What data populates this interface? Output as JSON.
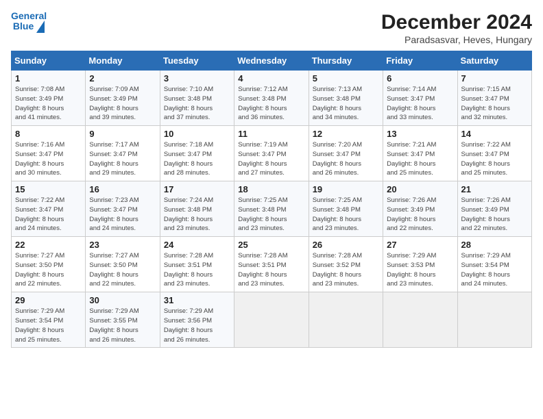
{
  "logo": {
    "line1": "General",
    "line2": "Blue"
  },
  "title": "December 2024",
  "subtitle": "Paradsasvar, Heves, Hungary",
  "days_of_week": [
    "Sunday",
    "Monday",
    "Tuesday",
    "Wednesday",
    "Thursday",
    "Friday",
    "Saturday"
  ],
  "weeks": [
    [
      {
        "day": 1,
        "sunrise": "7:08 AM",
        "sunset": "3:49 PM",
        "daylight": "8 hours and 41 minutes."
      },
      {
        "day": 2,
        "sunrise": "7:09 AM",
        "sunset": "3:49 PM",
        "daylight": "8 hours and 39 minutes."
      },
      {
        "day": 3,
        "sunrise": "7:10 AM",
        "sunset": "3:48 PM",
        "daylight": "8 hours and 37 minutes."
      },
      {
        "day": 4,
        "sunrise": "7:12 AM",
        "sunset": "3:48 PM",
        "daylight": "8 hours and 36 minutes."
      },
      {
        "day": 5,
        "sunrise": "7:13 AM",
        "sunset": "3:48 PM",
        "daylight": "8 hours and 34 minutes."
      },
      {
        "day": 6,
        "sunrise": "7:14 AM",
        "sunset": "3:47 PM",
        "daylight": "8 hours and 33 minutes."
      },
      {
        "day": 7,
        "sunrise": "7:15 AM",
        "sunset": "3:47 PM",
        "daylight": "8 hours and 32 minutes."
      }
    ],
    [
      {
        "day": 8,
        "sunrise": "7:16 AM",
        "sunset": "3:47 PM",
        "daylight": "8 hours and 30 minutes."
      },
      {
        "day": 9,
        "sunrise": "7:17 AM",
        "sunset": "3:47 PM",
        "daylight": "8 hours and 29 minutes."
      },
      {
        "day": 10,
        "sunrise": "7:18 AM",
        "sunset": "3:47 PM",
        "daylight": "8 hours and 28 minutes."
      },
      {
        "day": 11,
        "sunrise": "7:19 AM",
        "sunset": "3:47 PM",
        "daylight": "8 hours and 27 minutes."
      },
      {
        "day": 12,
        "sunrise": "7:20 AM",
        "sunset": "3:47 PM",
        "daylight": "8 hours and 26 minutes."
      },
      {
        "day": 13,
        "sunrise": "7:21 AM",
        "sunset": "3:47 PM",
        "daylight": "8 hours and 25 minutes."
      },
      {
        "day": 14,
        "sunrise": "7:22 AM",
        "sunset": "3:47 PM",
        "daylight": "8 hours and 25 minutes."
      }
    ],
    [
      {
        "day": 15,
        "sunrise": "7:22 AM",
        "sunset": "3:47 PM",
        "daylight": "8 hours and 24 minutes."
      },
      {
        "day": 16,
        "sunrise": "7:23 AM",
        "sunset": "3:47 PM",
        "daylight": "8 hours and 24 minutes."
      },
      {
        "day": 17,
        "sunrise": "7:24 AM",
        "sunset": "3:48 PM",
        "daylight": "8 hours and 23 minutes."
      },
      {
        "day": 18,
        "sunrise": "7:25 AM",
        "sunset": "3:48 PM",
        "daylight": "8 hours and 23 minutes."
      },
      {
        "day": 19,
        "sunrise": "7:25 AM",
        "sunset": "3:48 PM",
        "daylight": "8 hours and 23 minutes."
      },
      {
        "day": 20,
        "sunrise": "7:26 AM",
        "sunset": "3:49 PM",
        "daylight": "8 hours and 22 minutes."
      },
      {
        "day": 21,
        "sunrise": "7:26 AM",
        "sunset": "3:49 PM",
        "daylight": "8 hours and 22 minutes."
      }
    ],
    [
      {
        "day": 22,
        "sunrise": "7:27 AM",
        "sunset": "3:50 PM",
        "daylight": "8 hours and 22 minutes."
      },
      {
        "day": 23,
        "sunrise": "7:27 AM",
        "sunset": "3:50 PM",
        "daylight": "8 hours and 22 minutes."
      },
      {
        "day": 24,
        "sunrise": "7:28 AM",
        "sunset": "3:51 PM",
        "daylight": "8 hours and 23 minutes."
      },
      {
        "day": 25,
        "sunrise": "7:28 AM",
        "sunset": "3:51 PM",
        "daylight": "8 hours and 23 minutes."
      },
      {
        "day": 26,
        "sunrise": "7:28 AM",
        "sunset": "3:52 PM",
        "daylight": "8 hours and 23 minutes."
      },
      {
        "day": 27,
        "sunrise": "7:29 AM",
        "sunset": "3:53 PM",
        "daylight": "8 hours and 23 minutes."
      },
      {
        "day": 28,
        "sunrise": "7:29 AM",
        "sunset": "3:54 PM",
        "daylight": "8 hours and 24 minutes."
      }
    ],
    [
      {
        "day": 29,
        "sunrise": "7:29 AM",
        "sunset": "3:54 PM",
        "daylight": "8 hours and 25 minutes."
      },
      {
        "day": 30,
        "sunrise": "7:29 AM",
        "sunset": "3:55 PM",
        "daylight": "8 hours and 26 minutes."
      },
      {
        "day": 31,
        "sunrise": "7:29 AM",
        "sunset": "3:56 PM",
        "daylight": "8 hours and 26 minutes."
      },
      null,
      null,
      null,
      null
    ]
  ]
}
